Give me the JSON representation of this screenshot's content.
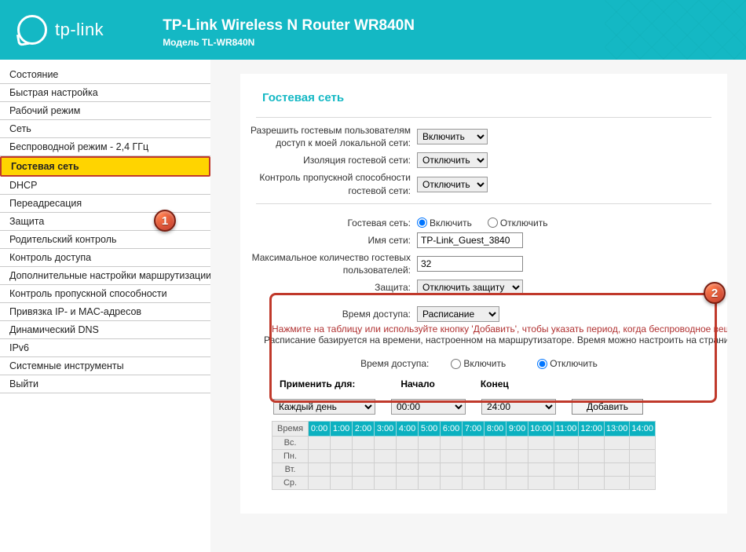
{
  "header": {
    "brand": "tp-link",
    "title": "TP-Link Wireless N Router WR840N",
    "model": "Модель TL-WR840N"
  },
  "nav": {
    "items": [
      "Состояние",
      "Быстрая настройка",
      "Рабочий режим",
      "Сеть",
      "Беспроводной режим - 2,4 ГГц",
      "Гостевая сеть",
      "DHCP",
      "Переадресация",
      "Защита",
      "Родительский контроль",
      "Контроль доступа",
      "Дополнительные настройки маршрутизации",
      "Контроль пропускной способности",
      "Привязка IP- и MAC-адресов",
      "Динамический DNS",
      "IPv6",
      "Системные инструменты",
      "Выйти"
    ],
    "activeIndex": 5
  },
  "badges": {
    "b1": "1",
    "b2": "2"
  },
  "opts": {
    "enable": "Включить",
    "disable": "Отключить"
  },
  "page": {
    "title": "Гостевая сеть",
    "rows": {
      "allow_local": "Разрешить гостевым пользователям доступ к моей локальной сети:",
      "isolation": "Изоляция гостевой сети:",
      "bandwidth": "Контроль пропускной способности гостевой сети:",
      "guest_net": "Гостевая сеть:",
      "ssid": "Имя сети:",
      "max_users": "Максимальное количество гостевых пользователей:",
      "security": "Защита:",
      "access_time": "Время доступа:"
    },
    "values": {
      "allow_local": "Включить",
      "isolation": "Отключить",
      "bandwidth": "Отключить",
      "guest_radio": "enable",
      "ssid": "TP-Link_Guest_3840",
      "max_users": "32",
      "security": "Отключить защиту",
      "access_time": "Расписание"
    },
    "help1": "Нажмите на таблицу или используйте кнопку 'Добавить', чтобы указать период, когда беспроводное вещание будет от…",
    "help2": "Расписание базируется на времени, настроенном на маршрутизаторе. Время можно настроить на странице \"Системные и…",
    "access_row_label": "Время доступа:",
    "access_radio": "disable",
    "apply_labels": {
      "for": "Применить для:",
      "start": "Начало",
      "end": "Конец"
    },
    "apply_values": {
      "day": "Каждый день",
      "start": "00:00",
      "end": "24:00"
    },
    "add_btn": "Добавить",
    "sched": {
      "time_label": "Время",
      "hours": [
        "0:00",
        "1:00",
        "2:00",
        "3:00",
        "4:00",
        "5:00",
        "6:00",
        "7:00",
        "8:00",
        "9:00",
        "10:00",
        "11:00",
        "12:00",
        "13:00",
        "14:00"
      ],
      "days": [
        "Вс.",
        "Пн.",
        "Вт.",
        "Ср."
      ]
    }
  }
}
